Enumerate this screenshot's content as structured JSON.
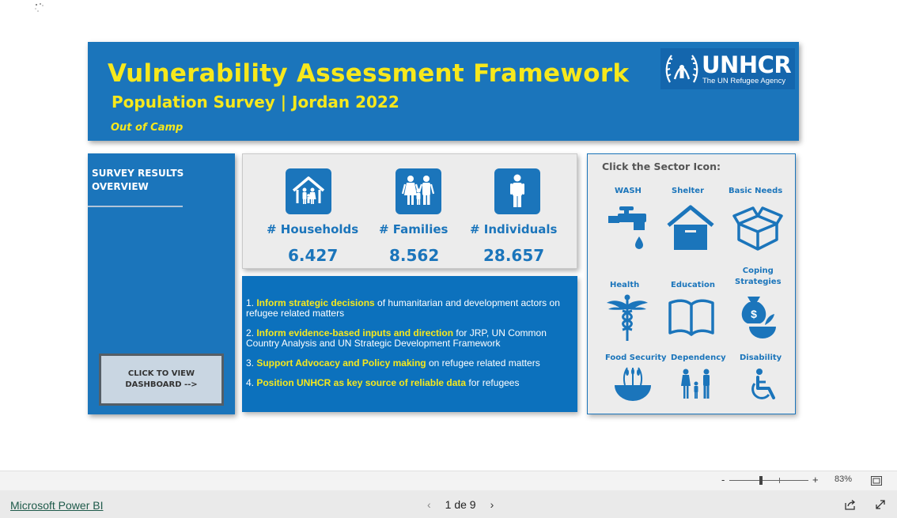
{
  "header": {
    "title": "Vulnerability Assessment Framework",
    "subtitle": "Population Survey | Jordan 2022",
    "tag": "Out of Camp",
    "logo_word": "UNHCR",
    "logo_tagline": "The UN Refugee Agency"
  },
  "left_panel": {
    "heading_line1": "SURVEY RESULTS",
    "heading_line2": "OVERVIEW",
    "dashboard_button_line1": "CLICK TO VIEW",
    "dashboard_button_line2": "DASHBOARD -->"
  },
  "stats": [
    {
      "label": "# Households",
      "value": "6.427",
      "icon": "house-family-icon"
    },
    {
      "label": "# Families",
      "value": "8.562",
      "icon": "family-icon"
    },
    {
      "label": "# Individuals",
      "value": "28.657",
      "icon": "person-icon"
    }
  ],
  "purpose": [
    {
      "num": "1. ",
      "highlight": "Inform strategic decisions",
      "rest": " of humanitarian and development actors on refugee related matters"
    },
    {
      "num": "2. ",
      "highlight": "Inform evidence-based inputs and direction",
      "rest": " for JRP, UN Common Country Analysis and UN Strategic Development Framework"
    },
    {
      "num": "3. ",
      "highlight": "Support Advocacy and Policy making",
      "rest": " on refugee related matters"
    },
    {
      "num": "4. ",
      "highlight": "Position UNHCR as key source of reliable data",
      "rest": " for refugees"
    }
  ],
  "sectors": {
    "heading": "Click the Sector Icon:",
    "wash": "WASH",
    "shelter": "Shelter",
    "basic_needs": "Basic Needs",
    "health": "Health",
    "education": "Education",
    "coping_line1": "Coping",
    "coping_line2": "Strategies",
    "food_security": "Food Security",
    "dependency": "Dependency",
    "disability": "Disability"
  },
  "status_bar": {
    "zoom_minus": "-",
    "zoom_plus": "+",
    "zoom_level": "83%"
  },
  "footer": {
    "brand_link": "Microsoft Power BI",
    "page_indicator": "1 de 9"
  },
  "colors": {
    "brand_blue": "#1b75bb",
    "highlight_yellow": "#f7e81c",
    "panel_gray": "#ececec"
  }
}
